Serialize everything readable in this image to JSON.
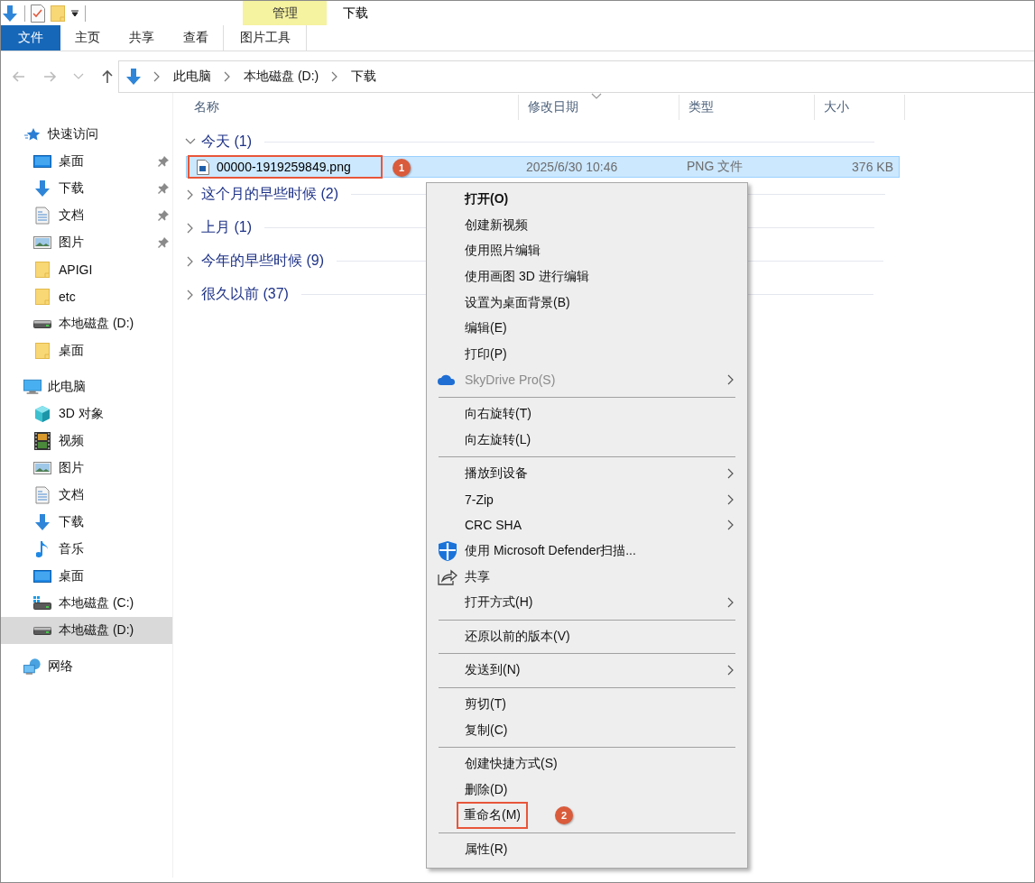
{
  "title_bar": {
    "context_tab": "管理",
    "title": "下载"
  },
  "ribbon_tabs": [
    {
      "label": "文件",
      "kind": "file",
      "selected": false
    },
    {
      "label": "主页",
      "kind": "tab",
      "selected": false
    },
    {
      "label": "共享",
      "kind": "tab",
      "selected": false
    },
    {
      "label": "查看",
      "kind": "tab",
      "selected": false
    },
    {
      "label": "图片工具",
      "kind": "context",
      "selected": false
    }
  ],
  "breadcrumbs": [
    "此电脑",
    "本地磁盘 (D:)",
    "下载"
  ],
  "sidebar": [
    {
      "label": "快速访问",
      "kind": "star",
      "selected": false,
      "children": [
        {
          "label": "桌面",
          "kind": "desktop",
          "pinned": true,
          "selected": false
        },
        {
          "label": "下载",
          "kind": "download",
          "pinned": true,
          "selected": false
        },
        {
          "label": "文档",
          "kind": "document",
          "pinned": true,
          "selected": false
        },
        {
          "label": "图片",
          "kind": "picture",
          "pinned": true,
          "selected": false
        },
        {
          "label": "APIGI",
          "kind": "folder",
          "pinned": false,
          "selected": false
        },
        {
          "label": "etc",
          "kind": "folder",
          "pinned": false,
          "selected": false
        },
        {
          "label": "本地磁盘 (D:)",
          "kind": "drive",
          "pinned": false,
          "selected": false
        },
        {
          "label": "桌面",
          "kind": "folder",
          "pinned": false,
          "selected": false
        }
      ]
    },
    {
      "label": "此电脑",
      "kind": "pc",
      "selected": false,
      "children": [
        {
          "label": "3D 对象",
          "kind": "cube",
          "pinned": false,
          "selected": false
        },
        {
          "label": "视频",
          "kind": "video",
          "pinned": false,
          "selected": false
        },
        {
          "label": "图片",
          "kind": "picture",
          "pinned": false,
          "selected": false
        },
        {
          "label": "文档",
          "kind": "document",
          "pinned": false,
          "selected": false
        },
        {
          "label": "下载",
          "kind": "download",
          "pinned": false,
          "selected": false
        },
        {
          "label": "音乐",
          "kind": "music",
          "pinned": false,
          "selected": false
        },
        {
          "label": "桌面",
          "kind": "desktop",
          "pinned": false,
          "selected": false
        },
        {
          "label": "本地磁盘 (C:)",
          "kind": "windrive",
          "pinned": false,
          "selected": false
        },
        {
          "label": "本地磁盘 (D:)",
          "kind": "drive",
          "pinned": false,
          "selected": true
        }
      ]
    },
    {
      "label": "网络",
      "kind": "network",
      "selected": false
    }
  ],
  "columns": [
    "名称",
    "修改日期",
    "类型",
    "大小"
  ],
  "groups": [
    {
      "label": "今天 (1)",
      "expanded": true,
      "files": [
        {
          "name": "00000-1919259849.png",
          "date": "2025/6/30 10:46",
          "type": "PNG 文件",
          "size": "376 KB",
          "selected": true,
          "marked": true,
          "callout": "1"
        }
      ]
    },
    {
      "label": "这个月的早些时候 (2)",
      "expanded": false
    },
    {
      "label": "上月 (1)",
      "expanded": false
    },
    {
      "label": "今年的早些时候 (9)",
      "expanded": false
    },
    {
      "label": "很久以前 (37)",
      "expanded": false
    }
  ],
  "context_menu": [
    {
      "kind": "plain",
      "label": "打开(O)",
      "bold": true
    },
    {
      "kind": "plain",
      "label": "创建新视频"
    },
    {
      "kind": "plain",
      "label": "使用照片编辑"
    },
    {
      "kind": "plain",
      "label": "使用画图 3D 进行编辑"
    },
    {
      "kind": "plain",
      "label": "设置为桌面背景(B)"
    },
    {
      "kind": "plain",
      "label": "编辑(E)"
    },
    {
      "kind": "plain",
      "label": "打印(P)"
    },
    {
      "kind": "cloud",
      "label": "SkyDrive Pro(S)",
      "disabled": true,
      "submenu": true
    },
    {
      "kind": "separator"
    },
    {
      "kind": "plain",
      "label": "向右旋转(T)"
    },
    {
      "kind": "plain",
      "label": "向左旋转(L)"
    },
    {
      "kind": "separator"
    },
    {
      "kind": "plain",
      "label": "播放到设备",
      "submenu": true
    },
    {
      "kind": "plain",
      "label": "7-Zip",
      "submenu": true
    },
    {
      "kind": "plain",
      "label": "CRC SHA",
      "submenu": true
    },
    {
      "kind": "shield",
      "label": "使用 Microsoft Defender扫描..."
    },
    {
      "kind": "share",
      "label": "共享"
    },
    {
      "kind": "plain",
      "label": "打开方式(H)",
      "submenu": true
    },
    {
      "kind": "separator"
    },
    {
      "kind": "plain",
      "label": "还原以前的版本(V)"
    },
    {
      "kind": "separator"
    },
    {
      "kind": "plain",
      "label": "发送到(N)",
      "submenu": true
    },
    {
      "kind": "separator"
    },
    {
      "kind": "plain",
      "label": "剪切(T)"
    },
    {
      "kind": "plain",
      "label": "复制(C)"
    },
    {
      "kind": "separator"
    },
    {
      "kind": "plain",
      "label": "创建快捷方式(S)"
    },
    {
      "kind": "plain",
      "label": "删除(D)"
    },
    {
      "kind": "plain",
      "label": "重命名(M)",
      "marked": true,
      "callout": "2"
    },
    {
      "kind": "separator"
    },
    {
      "kind": "plain",
      "label": "属性(R)"
    }
  ]
}
